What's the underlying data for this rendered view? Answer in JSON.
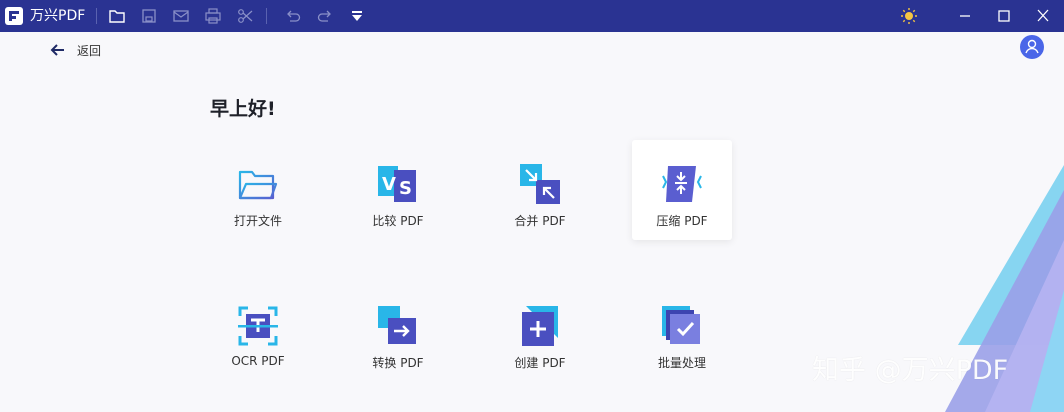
{
  "titlebar": {
    "app_name": "万兴PDF",
    "icons": [
      "folder-icon",
      "save-icon",
      "mail-icon",
      "print-icon",
      "scissors-icon",
      "undo-icon",
      "redo-icon",
      "dropdown-icon",
      "sun-icon",
      "minimize-icon",
      "maximize-icon",
      "close-icon"
    ]
  },
  "nav": {
    "back_label": "返回"
  },
  "main": {
    "greeting": "早上好!",
    "tools": [
      {
        "label": "打开文件",
        "icon": "open-folder-icon"
      },
      {
        "label": "比较 PDF",
        "icon": "compare-icon"
      },
      {
        "label": "合并 PDF",
        "icon": "merge-icon"
      },
      {
        "label": "压缩 PDF",
        "icon": "compress-icon"
      },
      {
        "label": "OCR PDF",
        "icon": "ocr-icon"
      },
      {
        "label": "转换 PDF",
        "icon": "convert-icon"
      },
      {
        "label": "创建 PDF",
        "icon": "create-icon"
      },
      {
        "label": "批量处理",
        "icon": "batch-icon"
      }
    ]
  },
  "watermark": "知乎 @万兴PDF",
  "colors": {
    "titlebar": "#2a3392",
    "accent": "#4a66e8",
    "icon_dark": "#4a4fc0",
    "icon_light": "#29b6e8"
  }
}
